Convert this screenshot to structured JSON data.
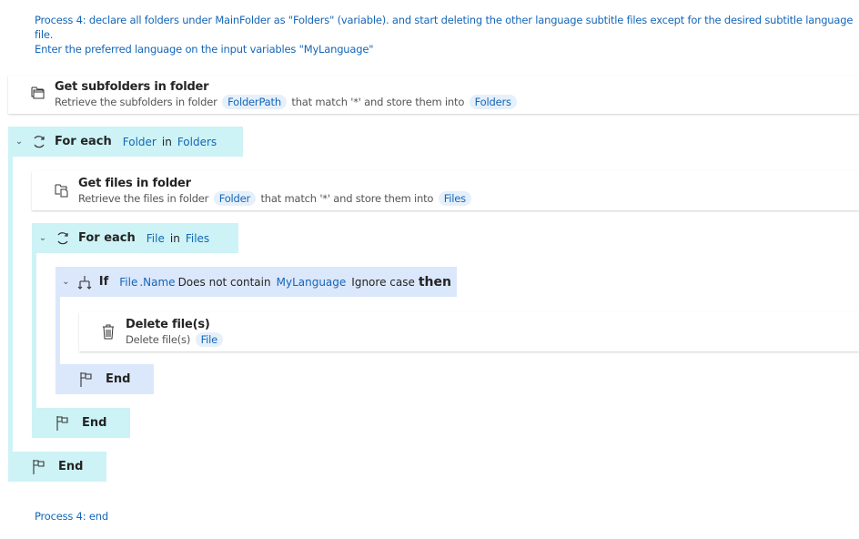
{
  "comment_start": {
    "line1": "Process 4: declare all folders under MainFolder as \"Folders\" (variable). and start deleting the other language subtitle files except for the desired subtitle language file.",
    "line2": "Enter the preferred language on the input variables \"MyLanguage\""
  },
  "get_subfolders": {
    "title": "Get subfolders in folder",
    "desc_1": "Retrieve the subfolders in folder",
    "var_1": "FolderPath",
    "desc_2": "that match '*' and store them into",
    "var_2": "Folders"
  },
  "foreach_folder": {
    "keyword": "For each",
    "item": "Folder",
    "in": "in",
    "collection": "Folders"
  },
  "get_files": {
    "title": "Get files in folder",
    "desc_1": "Retrieve the files in folder",
    "var_1": "Folder",
    "desc_2": "that match '*' and store them into",
    "var_2": "Files"
  },
  "foreach_file": {
    "keyword": "For each",
    "item": "File",
    "in": "in",
    "collection": "Files"
  },
  "if_block": {
    "keyword": "If",
    "var": "File",
    "property": ".Name",
    "operator": "Does not contain",
    "value": "MyLanguage",
    "option": "Ignore case",
    "then": "then"
  },
  "delete_files": {
    "title": "Delete file(s)",
    "desc": "Delete file(s)",
    "var": "File"
  },
  "end_label": "End",
  "comment_end": "Process 4: end",
  "colors": {
    "loop_bg": "#cdf3f6",
    "if_bg": "#dbe7fb",
    "variable": "#1466b8"
  }
}
